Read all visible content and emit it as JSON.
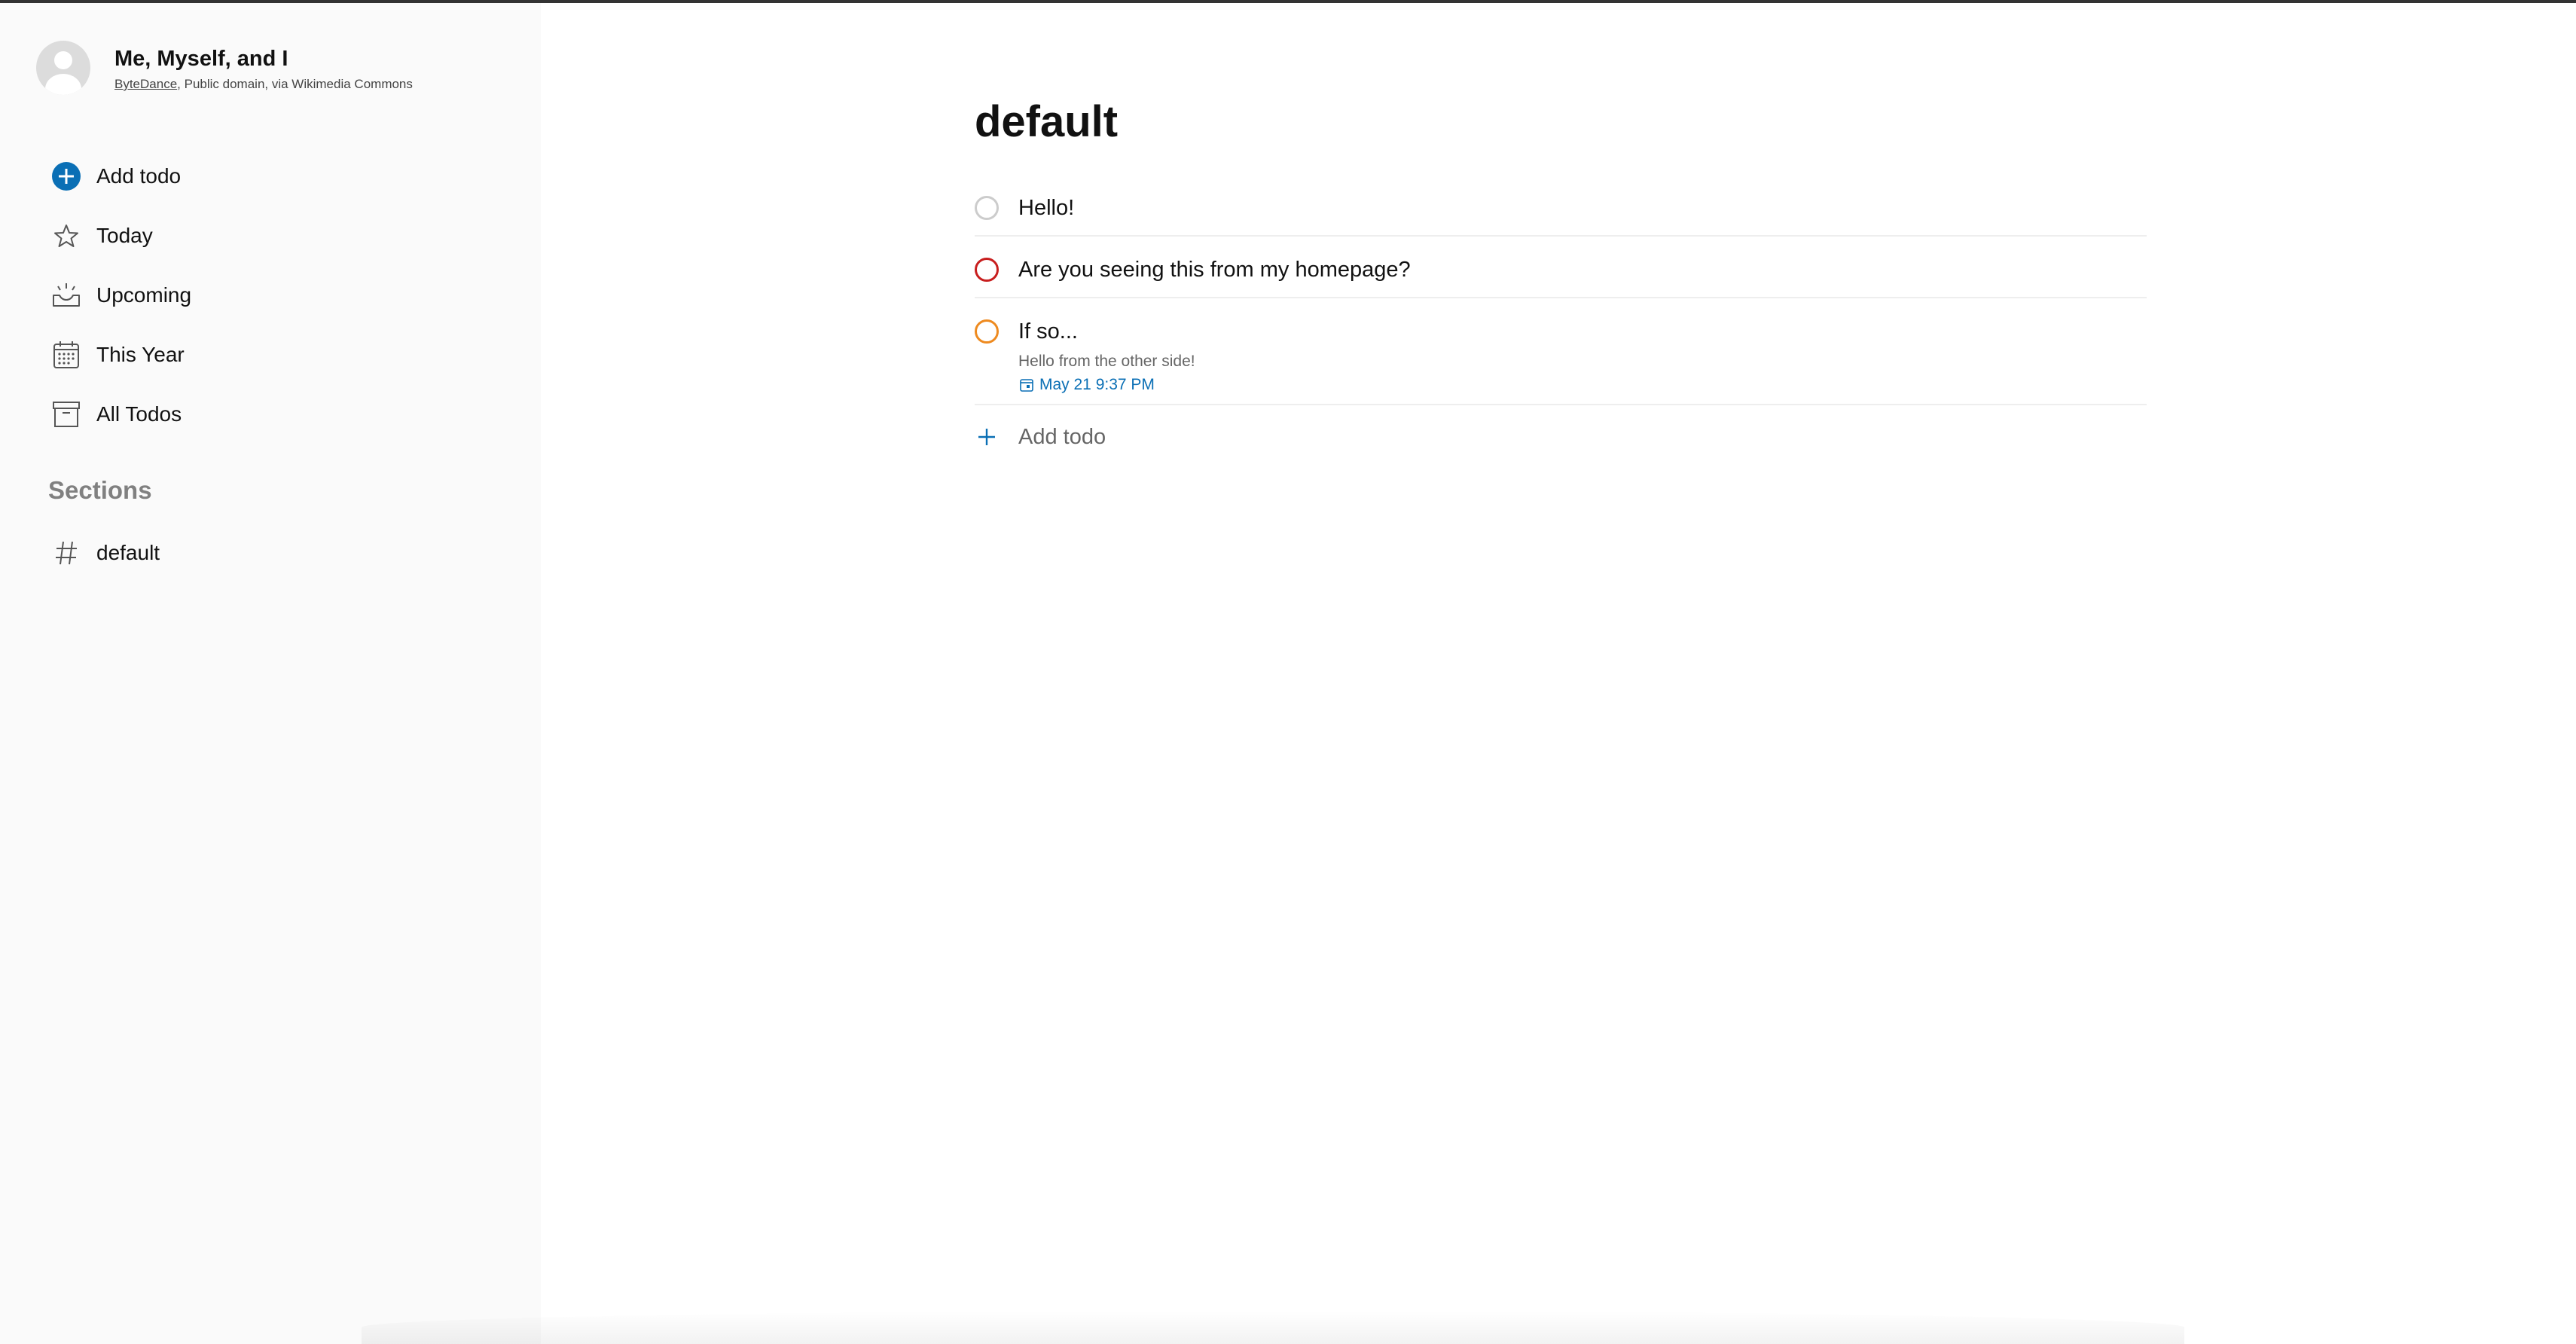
{
  "profile": {
    "name": "Me, Myself, and I",
    "credit_link": "ByteDance",
    "credit_rest": ", Public domain, via Wikimedia Commons"
  },
  "nav": {
    "items": [
      {
        "label": "Add todo",
        "icon": "add-circle-icon"
      },
      {
        "label": "Today",
        "icon": "star-icon"
      },
      {
        "label": "Upcoming",
        "icon": "sunrise-icon"
      },
      {
        "label": "This Year",
        "icon": "calendar-icon"
      },
      {
        "label": "All Todos",
        "icon": "archive-icon"
      }
    ]
  },
  "sections": {
    "heading": "Sections",
    "items": [
      {
        "label": "default",
        "icon": "hash-icon"
      }
    ]
  },
  "main": {
    "title": "default",
    "todos": [
      {
        "title": "Hello!",
        "priority_color": "#cccccc"
      },
      {
        "title": "Are you seeing this from my homepage?",
        "priority_color": "#c81e1e"
      },
      {
        "title": "If so...",
        "description": "Hello from the other side!",
        "due": "May 21 9:37 PM",
        "priority_color": "#ee8a1f"
      }
    ],
    "add_label": "Add todo"
  },
  "colors": {
    "accent": "#0a6fb5",
    "sidebar_bg": "#fafafa"
  }
}
